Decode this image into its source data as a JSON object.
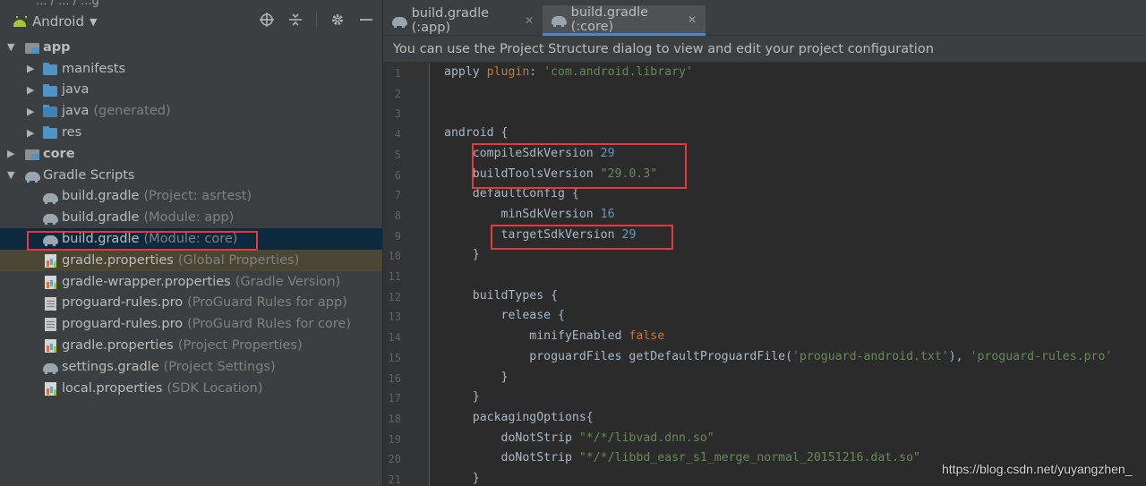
{
  "top_fragment": "... / ... / ...g",
  "project_panel": {
    "view_selector": "Android",
    "tools": [
      "crosshair-icon",
      "collapse-all-icon",
      "gear-icon",
      "minimize-icon"
    ],
    "tree": [
      {
        "label": "app",
        "hint": "",
        "indent": 0,
        "arrow": "▼",
        "icon": "module",
        "bold": true
      },
      {
        "label": "manifests",
        "hint": "",
        "indent": 1,
        "arrow": "▶",
        "icon": "folder"
      },
      {
        "label": "java",
        "hint": "",
        "indent": 1,
        "arrow": "▶",
        "icon": "folder"
      },
      {
        "label": "java",
        "hint": "(generated)",
        "indent": 1,
        "arrow": "▶",
        "icon": "folder-gen"
      },
      {
        "label": "res",
        "hint": "",
        "indent": 1,
        "arrow": "▶",
        "icon": "folder"
      },
      {
        "label": "core",
        "hint": "",
        "indent": 0,
        "arrow": "▶",
        "icon": "module",
        "bold": true
      },
      {
        "label": "Gradle Scripts",
        "hint": "",
        "indent": 0,
        "arrow": "▼",
        "icon": "elephant"
      },
      {
        "label": "build.gradle",
        "hint": "(Project: asrtest)",
        "indent": 1,
        "arrow": "",
        "icon": "elephant"
      },
      {
        "label": "build.gradle",
        "hint": "(Module: app)",
        "indent": 1,
        "arrow": "",
        "icon": "elephant"
      },
      {
        "label": "build.gradle",
        "hint": "(Module: core)",
        "indent": 1,
        "arrow": "",
        "icon": "elephant",
        "state": "selected"
      },
      {
        "label": "gradle.properties",
        "hint": "(Global Properties)",
        "indent": 1,
        "arrow": "",
        "icon": "props",
        "state": "hover"
      },
      {
        "label": "gradle-wrapper.properties",
        "hint": "(Gradle Version)",
        "indent": 1,
        "arrow": "",
        "icon": "props"
      },
      {
        "label": "proguard-rules.pro",
        "hint": "(ProGuard Rules for app)",
        "indent": 1,
        "arrow": "",
        "icon": "pro"
      },
      {
        "label": "proguard-rules.pro",
        "hint": "(ProGuard Rules for core)",
        "indent": 1,
        "arrow": "",
        "icon": "pro"
      },
      {
        "label": "gradle.properties",
        "hint": "(Project Properties)",
        "indent": 1,
        "arrow": "",
        "icon": "props"
      },
      {
        "label": "settings.gradle",
        "hint": "(Project Settings)",
        "indent": 1,
        "arrow": "",
        "icon": "elephant"
      },
      {
        "label": "local.properties",
        "hint": "(SDK Location)",
        "indent": 1,
        "arrow": "",
        "icon": "props"
      }
    ]
  },
  "editor": {
    "tabs": [
      {
        "label": "build.gradle (:app)",
        "active": false
      },
      {
        "label": "build.gradle (:core)",
        "active": true
      }
    ],
    "notice": "You can use the Project Structure dialog to view and edit your project configuration",
    "lines": [
      [
        {
          "t": "apply ",
          "c": "plain"
        },
        {
          "t": "plugin",
          "c": "kw"
        },
        {
          "t": ": ",
          "c": "plain"
        },
        {
          "t": "'com.android.library'",
          "c": "str"
        }
      ],
      [],
      [],
      [
        {
          "t": "android {",
          "c": "plain"
        }
      ],
      [
        {
          "t": "    compileSdkVersion ",
          "c": "plain"
        },
        {
          "t": "29",
          "c": "num"
        }
      ],
      [
        {
          "t": "    buildToolsVersion ",
          "c": "plain"
        },
        {
          "t": "\"29.0.3\"",
          "c": "str"
        }
      ],
      [
        {
          "t": "    defaultConfig {",
          "c": "plain"
        }
      ],
      [
        {
          "t": "        minSdkVersion ",
          "c": "plain"
        },
        {
          "t": "16",
          "c": "num"
        }
      ],
      [
        {
          "t": "        targetSdkVersion ",
          "c": "plain"
        },
        {
          "t": "29",
          "c": "num"
        }
      ],
      [
        {
          "t": "    }",
          "c": "plain"
        }
      ],
      [],
      [
        {
          "t": "    buildTypes {",
          "c": "plain"
        }
      ],
      [
        {
          "t": "        release {",
          "c": "plain"
        }
      ],
      [
        {
          "t": "            minifyEnabled ",
          "c": "plain"
        },
        {
          "t": "false",
          "c": "kw"
        }
      ],
      [
        {
          "t": "            proguardFiles getDefaultProguardFile(",
          "c": "plain"
        },
        {
          "t": "'proguard-android.txt'",
          "c": "str"
        },
        {
          "t": "), ",
          "c": "plain"
        },
        {
          "t": "'proguard-rules.pro'",
          "c": "str"
        }
      ],
      [
        {
          "t": "        }",
          "c": "plain"
        }
      ],
      [
        {
          "t": "    }",
          "c": "plain"
        }
      ],
      [
        {
          "t": "    packagingOptions{",
          "c": "plain"
        }
      ],
      [
        {
          "t": "        doNotStrip ",
          "c": "plain"
        },
        {
          "t": "\"*/*/libvad.dnn.so\"",
          "c": "str"
        }
      ],
      [
        {
          "t": "        doNotStrip ",
          "c": "plain"
        },
        {
          "t": "\"*/*/libbd_easr_s1_merge_normal_20151216.dat.so\"",
          "c": "str"
        }
      ],
      [
        {
          "t": "    }",
          "c": "plain"
        }
      ]
    ],
    "fold_lines": [
      4,
      7,
      10,
      12,
      13,
      16,
      17,
      18,
      21
    ]
  },
  "watermark": "https://blog.csdn.net/yuyangzhen_",
  "colors": {
    "panel_bg": "#3c3f41",
    "editor_bg": "#2b2b2b",
    "selection": "#0d293e",
    "highlight_box": "#e8383d",
    "keyword": "#cc7832",
    "string": "#6a8759",
    "number": "#6897bb"
  }
}
